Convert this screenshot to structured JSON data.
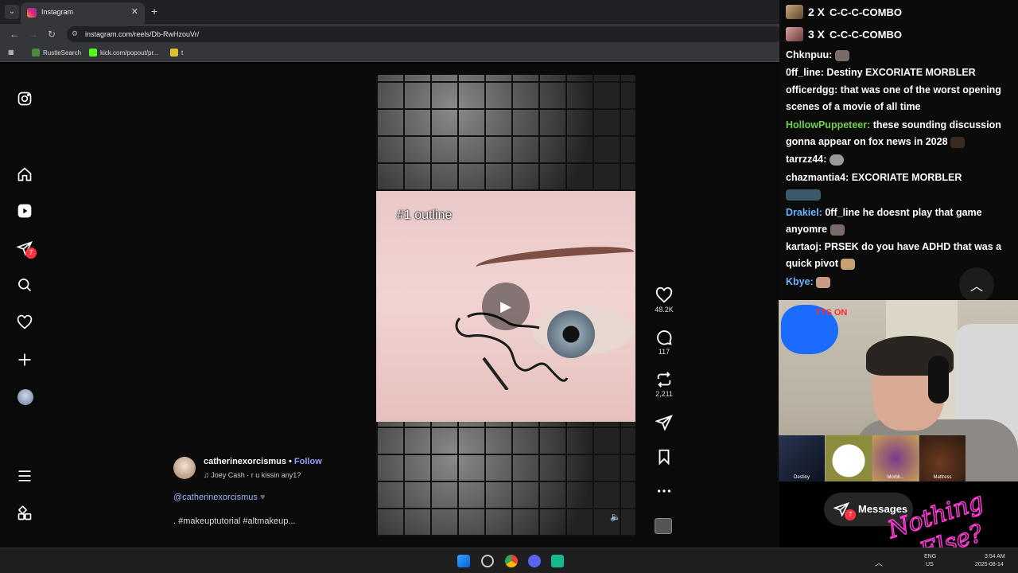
{
  "browser": {
    "tab_title": "Instagram",
    "url": "instagram.com/reels/Db-RwHzouVr/",
    "bookmarks": [
      "RustleSearch",
      "kick.com/popout/pr...",
      "t"
    ]
  },
  "sidebar": {
    "items": [
      "instagram-logo",
      "home",
      "reels",
      "messages",
      "search",
      "notifications",
      "create",
      "profile",
      "more",
      "also-from-meta"
    ],
    "messages_badge": "7"
  },
  "reel": {
    "overlay_caption": "#1 outline",
    "likes": "48.2K",
    "comments": "117",
    "reposts": "2,211",
    "author": "catherinexorcismus",
    "follow_label": "Follow",
    "separator": "•",
    "song": "Joey Cash · r u kissin any1?",
    "description_mention": "@catherinexorcismus",
    "description_text": ". #makeuptutorial #altmakeup..."
  },
  "stream": {
    "combos": [
      {
        "count": "2 X",
        "label": "C-C-C-COMBO"
      },
      {
        "count": "3 X",
        "label": "C-C-C-COMBO"
      }
    ],
    "chat": [
      {
        "user": "Chknpuu:",
        "color": "#ffffff",
        "text": ""
      },
      {
        "user": "0ff_line:",
        "color": "#ffffff",
        "text": "Destiny EXCORIATE MORBLER"
      },
      {
        "user": "officerdgg:",
        "color": "#ffffff",
        "text": "that was one of the worst opening scenes of a movie of all time"
      },
      {
        "user": "HollowPuppeteer:",
        "color": "#6fd24a",
        "text": "these sounding discussion gonna appear on fox news in 2028"
      },
      {
        "user": "tarrzz44:",
        "color": "#ffffff",
        "text": ""
      },
      {
        "user": "chazmantia4:",
        "color": "#ffffff",
        "text": "EXCORIATE MORBLER"
      },
      {
        "user": "Drakiel:",
        "color": "#6ab4ff",
        "text": "0ff_line he doesnt play that game anyomre"
      },
      {
        "user": "kartaoj:",
        "color": "#ffffff",
        "text": "PRSEK do you have ADHD that was a quick pivot"
      },
      {
        "user": "Kbye:",
        "color": "#6ab4ff",
        "text": ""
      }
    ],
    "tts_label": "TTS ON",
    "thumbnails": [
      "Destiny",
      "",
      "Morbli...",
      "Mattress"
    ],
    "messages_label": "Messages",
    "messages_badge": "7",
    "watermark": "Nothing Else?"
  },
  "taskbar": {
    "lang": "ENG",
    "region": "US",
    "time": "3:54 AM",
    "date": "2025-08-14"
  }
}
